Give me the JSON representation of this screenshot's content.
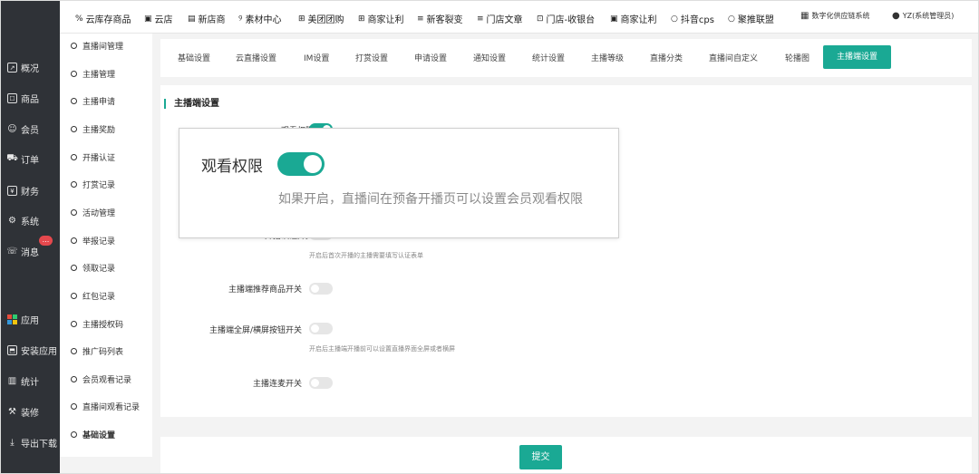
{
  "top_nav": {
    "items": [
      {
        "icon": "percent-icon",
        "glyph": "%",
        "label": "云库存商品"
      },
      {
        "icon": "image-icon",
        "glyph": "▣",
        "label": "云店"
      },
      {
        "icon": "list-icon",
        "glyph": "▤",
        "label": "新店商"
      },
      {
        "icon": "material-icon",
        "glyph": "୨",
        "label": "素材中心"
      },
      {
        "icon": "plus-box-icon",
        "glyph": "⊞",
        "label": "美团团购"
      },
      {
        "icon": "plus-box-icon",
        "glyph": "⊞",
        "label": "商家让利"
      },
      {
        "icon": "menu-icon",
        "glyph": "≡",
        "label": "新客裂变"
      },
      {
        "icon": "menu-icon",
        "glyph": "≡",
        "label": "门店文章"
      },
      {
        "icon": "cashier-icon",
        "glyph": "⊡",
        "label": "门店-收银台"
      },
      {
        "icon": "image-icon",
        "glyph": "▣",
        "label": "商家让利"
      },
      {
        "icon": "circle-icon",
        "glyph": "○",
        "label": "抖音cps"
      },
      {
        "icon": "circle-icon",
        "glyph": "○",
        "label": "聚推联盟"
      }
    ],
    "system_label": "数字化供应链系统",
    "user_label": "YZ(系统管理员)"
  },
  "left_nav": {
    "items": [
      {
        "icon": "chart-icon",
        "glyph": "↗",
        "label": "概况"
      },
      {
        "icon": "goods-icon",
        "glyph": "☐",
        "label": "商品"
      },
      {
        "icon": "member-icon",
        "glyph": "☺",
        "label": "会员"
      },
      {
        "icon": "cart-icon",
        "glyph": "⛟",
        "label": "订单"
      },
      {
        "icon": "finance-icon",
        "glyph": "¥",
        "label": "财务"
      },
      {
        "icon": "gear-icon",
        "glyph": "⚙",
        "label": "系统"
      },
      {
        "icon": "message-icon",
        "glyph": "☏",
        "label": "消息"
      },
      {
        "icon": "apps-icon",
        "glyph": "",
        "label": "应用"
      },
      {
        "icon": "install-icon",
        "glyph": "⬒",
        "label": "安装应用"
      },
      {
        "icon": "stats-icon",
        "glyph": "▥",
        "label": "统计"
      },
      {
        "icon": "brush-icon",
        "glyph": "⚒",
        "label": "装修"
      },
      {
        "icon": "download-icon",
        "glyph": "⤓",
        "label": "导出下载"
      }
    ],
    "message_badge": "..."
  },
  "sub_nav": {
    "items": [
      "直播间管理",
      "主播管理",
      "主播申请",
      "主播奖励",
      "开播认证",
      "打赏记录",
      "活动管理",
      "举报记录",
      "领取记录",
      "红包记录",
      "主播授权码",
      "推广码列表",
      "会员观看记录",
      "直播间观看记录",
      "基础设置"
    ],
    "active": "基础设置"
  },
  "tabs": {
    "items": [
      "基础设置",
      "云直播设置",
      "IM设置",
      "打赏设置",
      "申请设置",
      "通知设置",
      "统计设置",
      "主播等级",
      "直播分类",
      "直播间自定义",
      "轮播图",
      "主播端设置"
    ],
    "active": "主播端设置"
  },
  "section": {
    "title": "主播端设置",
    "rows": [
      {
        "label": "观看权限",
        "on": true,
        "desc": ""
      },
      {
        "label": "开播认证开关",
        "on": false,
        "desc": "开启后首次开播的主播需要填写认证表单"
      },
      {
        "label": "主播端推荐商品开关",
        "on": false,
        "desc": ""
      },
      {
        "label": "主播端全屏/横屏按钮开关",
        "on": false,
        "desc": "开启后主播端开播前可以设置直播界面全屏或者横屏"
      },
      {
        "label": "主播连麦开关",
        "on": false,
        "desc": ""
      }
    ]
  },
  "zoom": {
    "label": "观看权限",
    "on": true,
    "desc": "如果开启，直播间在预备开播页可以设置会员观看权限"
  },
  "submit_label": "提交",
  "colors": {
    "accent": "#1aa994",
    "nav_bg": "#2f3237",
    "badge": "#e5484d"
  }
}
